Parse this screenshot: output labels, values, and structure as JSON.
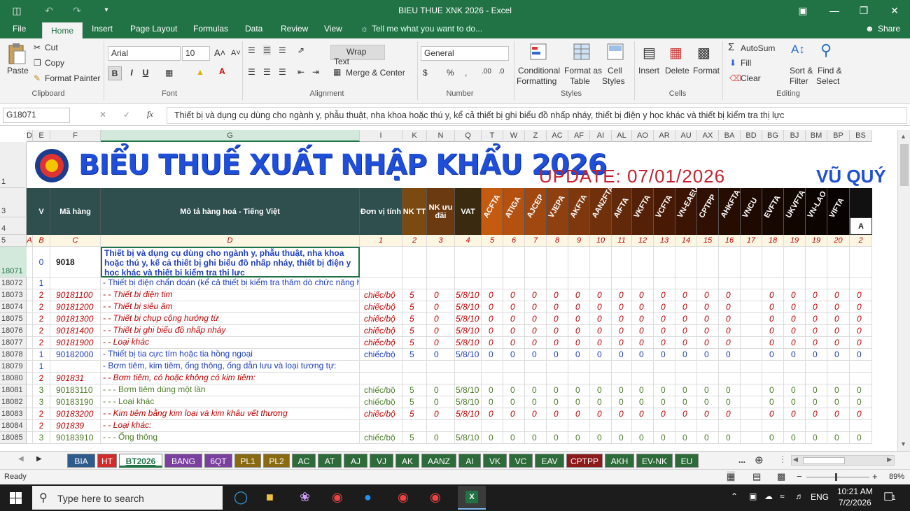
{
  "window": {
    "title": "BIEU THUE XNK 2026 - Excel"
  },
  "ribbon_tabs": [
    "File",
    "Home",
    "Insert",
    "Page Layout",
    "Formulas",
    "Data",
    "Review",
    "View"
  ],
  "tell_me": "Tell me what you want to do...",
  "share": "Share",
  "clipboard": {
    "paste": "Paste",
    "cut": "Cut",
    "copy": "Copy",
    "format_painter": "Format Painter",
    "group": "Clipboard"
  },
  "font": {
    "name": "Arial",
    "size": "10",
    "group": "Font",
    "bold": "B",
    "italic": "I",
    "underline": "U"
  },
  "alignment": {
    "wrap": "Wrap Text",
    "merge": "Merge & Center",
    "group": "Alignment"
  },
  "number": {
    "format": "General",
    "currency": "$",
    "percent": "%",
    "comma": ",",
    "group": "Number"
  },
  "styles": {
    "conditional": "Conditional",
    "conditional2": "Formatting",
    "format_as": "Format as",
    "format_as2": "Table",
    "cell_styles": "Cell",
    "cell_styles2": "Styles",
    "group": "Styles"
  },
  "cells": {
    "insert": "Insert",
    "delete": "Delete",
    "format": "Format",
    "group": "Cells"
  },
  "editing": {
    "autosum": "AutoSum",
    "fill": "Fill",
    "clear": "Clear",
    "sort": "Sort &",
    "sort2": "Filter",
    "find": "Find &",
    "find2": "Select",
    "group": "Editing"
  },
  "formula_bar": {
    "name_box": "G18071",
    "fx": "fx",
    "content": "Thiết bị và dụng cụ dùng cho ngành y, phẫu thuật, nha khoa hoặc thú y, kể cả thiết bị ghi biểu đồ nhấp nháy, thiết bị điện y học khác và thiết bị kiểm tra thị lực"
  },
  "columns": [
    "D",
    "E",
    "F",
    "G",
    "I",
    "K",
    "N",
    "Q",
    "T",
    "W",
    "Z",
    "AC",
    "AF",
    "AI",
    "AL",
    "AO",
    "AR",
    "AU",
    "AX",
    "BA",
    "BD",
    "BG",
    "BJ",
    "BM",
    "BP",
    "BS"
  ],
  "sheet": {
    "banner": "BIỂU THUẾ XUẤT NHẬP KHẨU 2026",
    "update": "UPDATE: 07/01/2026",
    "author": "VŨ QUÝ",
    "headers": {
      "v": "V",
      "code": "Mã hàng",
      "desc": "Mô tả hàng hoá - Tiếng Việt",
      "unit": "Đơn vị tính",
      "nktt": "NK TT",
      "nkud": "NK ưu đãi",
      "vat": "VAT",
      "a": "A"
    },
    "fta": [
      "ACFTA",
      "ATIGA",
      "AJCEP",
      "VJEPA",
      "AKFTA",
      "AANZFTA",
      "AIFTA",
      "VKFTA",
      "VCFTA",
      "VN-EAEU",
      "CPTPP",
      "AHKFTA",
      "VNCU",
      "EVFTA",
      "UKVFTA",
      "VN-LAO",
      "VIFTA"
    ],
    "idx_row": [
      "A",
      "B",
      "C",
      "D",
      "1",
      "2",
      "3",
      "4",
      "5",
      "6",
      "7",
      "8",
      "9",
      "10",
      "11",
      "12",
      "13",
      "14",
      "15",
      "16",
      "17",
      "18",
      "19",
      "19",
      "20",
      "2"
    ],
    "row_headers": [
      "1",
      "3",
      "4",
      "5",
      "18071",
      "18072",
      "18073",
      "18074",
      "18075",
      "18076",
      "18077",
      "18078",
      "18079",
      "18080",
      "18081",
      "18082",
      "18083",
      "18084",
      "18085"
    ],
    "rows": [
      {
        "lvl": "0",
        "code": "9018",
        "desc": "Thiết bị và dụng cụ dùng cho ngành y, phẫu thuật, nha khoa hoặc thú y, kể cả thiết bị ghi biểu đồ nhấp nháy, thiết bị điện y học khác và thiết bị kiểm tra thị lực",
        "unit": "",
        "nktt": "",
        "nkud": "",
        "vat": "",
        "style": "bold"
      },
      {
        "lvl": "1",
        "code": "",
        "desc": "- Thiết bị điện chẩn đoán (kể cả thiết bị kiểm tra thăm dò chức năng hoặc kiểm tra thông số sinh lý):",
        "unit": "",
        "nktt": "",
        "nkud": "",
        "vat": "",
        "style": "blue"
      },
      {
        "lvl": "2",
        "code": "90181100",
        "desc": "- - Thiết bị điện tim",
        "unit": "chiếc/bộ",
        "nktt": "5",
        "nkud": "0",
        "vat": "5/8/10",
        "style": "red"
      },
      {
        "lvl": "2",
        "code": "90181200",
        "desc": "- - Thiết bị siêu âm",
        "unit": "chiếc/bộ",
        "nktt": "5",
        "nkud": "0",
        "vat": "5/8/10",
        "style": "red"
      },
      {
        "lvl": "2",
        "code": "90181300",
        "desc": "- - Thiết bị chụp cộng hưởng từ",
        "unit": "chiếc/bộ",
        "nktt": "5",
        "nkud": "0",
        "vat": "5/8/10",
        "style": "red"
      },
      {
        "lvl": "2",
        "code": "90181400",
        "desc": "- - Thiết bị ghi biểu đồ nhấp nháy",
        "unit": "chiếc/bộ",
        "nktt": "5",
        "nkud": "0",
        "vat": "5/8/10",
        "style": "red"
      },
      {
        "lvl": "2",
        "code": "90181900",
        "desc": "- - Loại khác",
        "unit": "chiếc/bộ",
        "nktt": "5",
        "nkud": "0",
        "vat": "5/8/10",
        "style": "red"
      },
      {
        "lvl": "1",
        "code": "90182000",
        "desc": "- Thiết bị tia cực tím hoặc tia hồng ngoại",
        "unit": "chiếc/bộ",
        "nktt": "5",
        "nkud": "0",
        "vat": "5/8/10",
        "style": "blue"
      },
      {
        "lvl": "1",
        "code": "",
        "desc": "- Bơm tiêm, kim tiêm, ống thông, ống dẫn lưu và loại tương tự:",
        "unit": "",
        "nktt": "",
        "nkud": "",
        "vat": "",
        "style": "blue"
      },
      {
        "lvl": "2",
        "code": "901831",
        "desc": "- - Bơm tiêm, có hoặc không có kim tiêm:",
        "unit": "",
        "nktt": "",
        "nkud": "",
        "vat": "",
        "style": "red"
      },
      {
        "lvl": "3",
        "code": "90183110",
        "desc": "- - - Bơm tiêm dùng một lần",
        "unit": "chiếc/bộ",
        "nktt": "5",
        "nkud": "0",
        "vat": "5/8/10",
        "style": "grn"
      },
      {
        "lvl": "3",
        "code": "90183190",
        "desc": "- - - Loại khác",
        "unit": "chiếc/bộ",
        "nktt": "5",
        "nkud": "0",
        "vat": "5/8/10",
        "style": "grn"
      },
      {
        "lvl": "2",
        "code": "90183200",
        "desc": "- - Kim tiêm bằng kim loại và kim khâu vết thương",
        "unit": "chiếc/bộ",
        "nktt": "5",
        "nkud": "0",
        "vat": "5/8/10",
        "style": "red"
      },
      {
        "lvl": "2",
        "code": "901839",
        "desc": "- - Loại khác:",
        "unit": "",
        "nktt": "",
        "nkud": "",
        "vat": "",
        "style": "red"
      },
      {
        "lvl": "3",
        "code": "90183910",
        "desc": "- - - Ống thông",
        "unit": "chiếc/bộ",
        "nktt": "5",
        "nkud": "0",
        "vat": "5/8/10",
        "style": "grn"
      }
    ],
    "zero": "0"
  },
  "sheet_tabs": [
    {
      "name": "BIA",
      "color": "#2e5a8c"
    },
    {
      "name": "HT",
      "color": "#d12c2c"
    },
    {
      "name": "BT2026",
      "color": "#ffffff"
    },
    {
      "name": "BANG",
      "color": "#7b3fa0"
    },
    {
      "name": "6QT",
      "color": "#7b3fa0"
    },
    {
      "name": "PL1",
      "color": "#8a6a10"
    },
    {
      "name": "PL2",
      "color": "#8a6a10"
    },
    {
      "name": "AC",
      "color": "#2e6b3a"
    },
    {
      "name": "AT",
      "color": "#2e6b3a"
    },
    {
      "name": "AJ",
      "color": "#2e6b3a"
    },
    {
      "name": "VJ",
      "color": "#2e6b3a"
    },
    {
      "name": "AK",
      "color": "#2e6b3a"
    },
    {
      "name": "AANZ",
      "color": "#2e6b3a"
    },
    {
      "name": "AI",
      "color": "#2e6b3a"
    },
    {
      "name": "VK",
      "color": "#2e6b3a"
    },
    {
      "name": "VC",
      "color": "#2e6b3a"
    },
    {
      "name": "EAV",
      "color": "#2e6b3a"
    },
    {
      "name": "CPTPP",
      "color": "#8b1a1a"
    },
    {
      "name": "AKH",
      "color": "#2e6b3a"
    },
    {
      "name": "EV-NK",
      "color": "#2e6b3a"
    },
    {
      "name": "EU",
      "color": "#2e6b3a"
    }
  ],
  "more_tabs": "...",
  "status": {
    "ready": "Ready",
    "zoom": "89%"
  },
  "taskbar": {
    "search": "Type here to search",
    "lang": "ENG",
    "time": "10:21 AM",
    "date": "7/2/2026",
    "notif": "1"
  }
}
